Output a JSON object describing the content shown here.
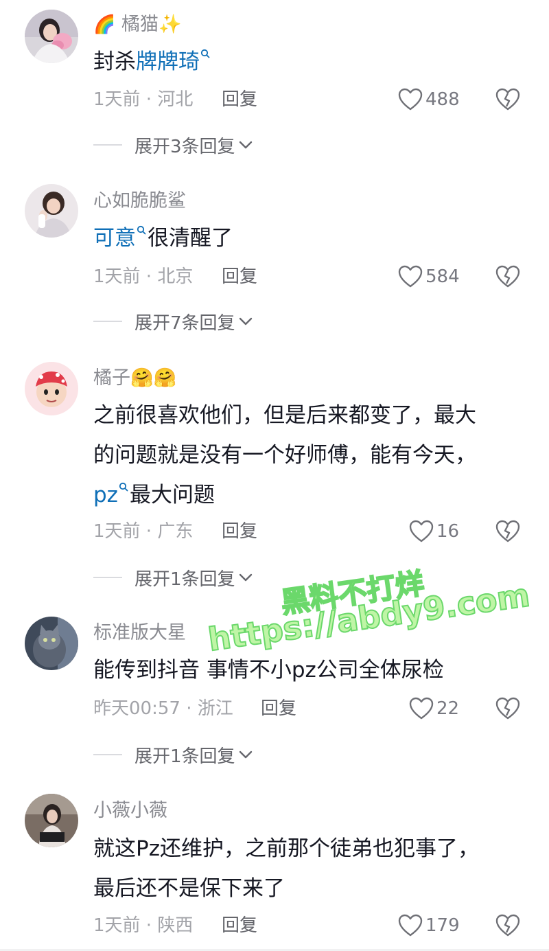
{
  "comments": [
    {
      "username": "橘猫",
      "username_prefix_emoji": "🌈",
      "username_suffix_emoji": "✨",
      "text_segments": [
        {
          "text": "封杀",
          "type": "plain"
        },
        {
          "text": "牌牌琦",
          "type": "link"
        }
      ],
      "time": "1天前",
      "location": "河北",
      "reply_label": "回复",
      "likes": "488",
      "expand_label": "展开3条回复"
    },
    {
      "username": "心如脆脆鲨",
      "text_segments": [
        {
          "text": "可意",
          "type": "link"
        },
        {
          "text": "很清醒了",
          "type": "plain"
        }
      ],
      "time": "1天前",
      "location": "北京",
      "reply_label": "回复",
      "likes": "584",
      "expand_label": "展开7条回复"
    },
    {
      "username": "橘子",
      "username_suffix_emoji": "🤗🤗",
      "text_lines": [
        "之前很喜欢他们，但是后来都变了，最大",
        "的问题就是没有一个好师傅，能有今天，"
      ],
      "text_segments_line3": [
        {
          "text": "pz",
          "type": "link"
        },
        {
          "text": "最大问题",
          "type": "plain"
        }
      ],
      "time": "1天前",
      "location": "广东",
      "reply_label": "回复",
      "likes": "16",
      "expand_label": "展开1条回复"
    },
    {
      "username": "标准版大星",
      "text": "能传到抖音 事情不小pz公司全体尿检",
      "time": "昨天00:57",
      "location": "浙江",
      "reply_label": "回复",
      "likes": "22",
      "expand_label": "展开1条回复"
    },
    {
      "username": "小薇小薇",
      "text_lines": [
        "就这Pz还维护，之前那个徒弟也犯事了，",
        "最后还不是保下来了"
      ],
      "time": "1天前",
      "location": "陕西",
      "reply_label": "回复",
      "likes": "179"
    }
  ],
  "separator": " · ",
  "watermark": {
    "line1": "黑料不打烊",
    "line2": "https://abdy9.com"
  },
  "colors": {
    "link": "#0f6fb7",
    "username": "#8a8b91",
    "meta": "#a2a3a8",
    "watermark_fill": "#bff5a6",
    "watermark_stroke": "#6bd86b"
  },
  "icons": {
    "like": "heart-outline-icon",
    "dislike": "broken-heart-icon",
    "expand": "chevron-down-icon",
    "link_search": "search-icon"
  }
}
